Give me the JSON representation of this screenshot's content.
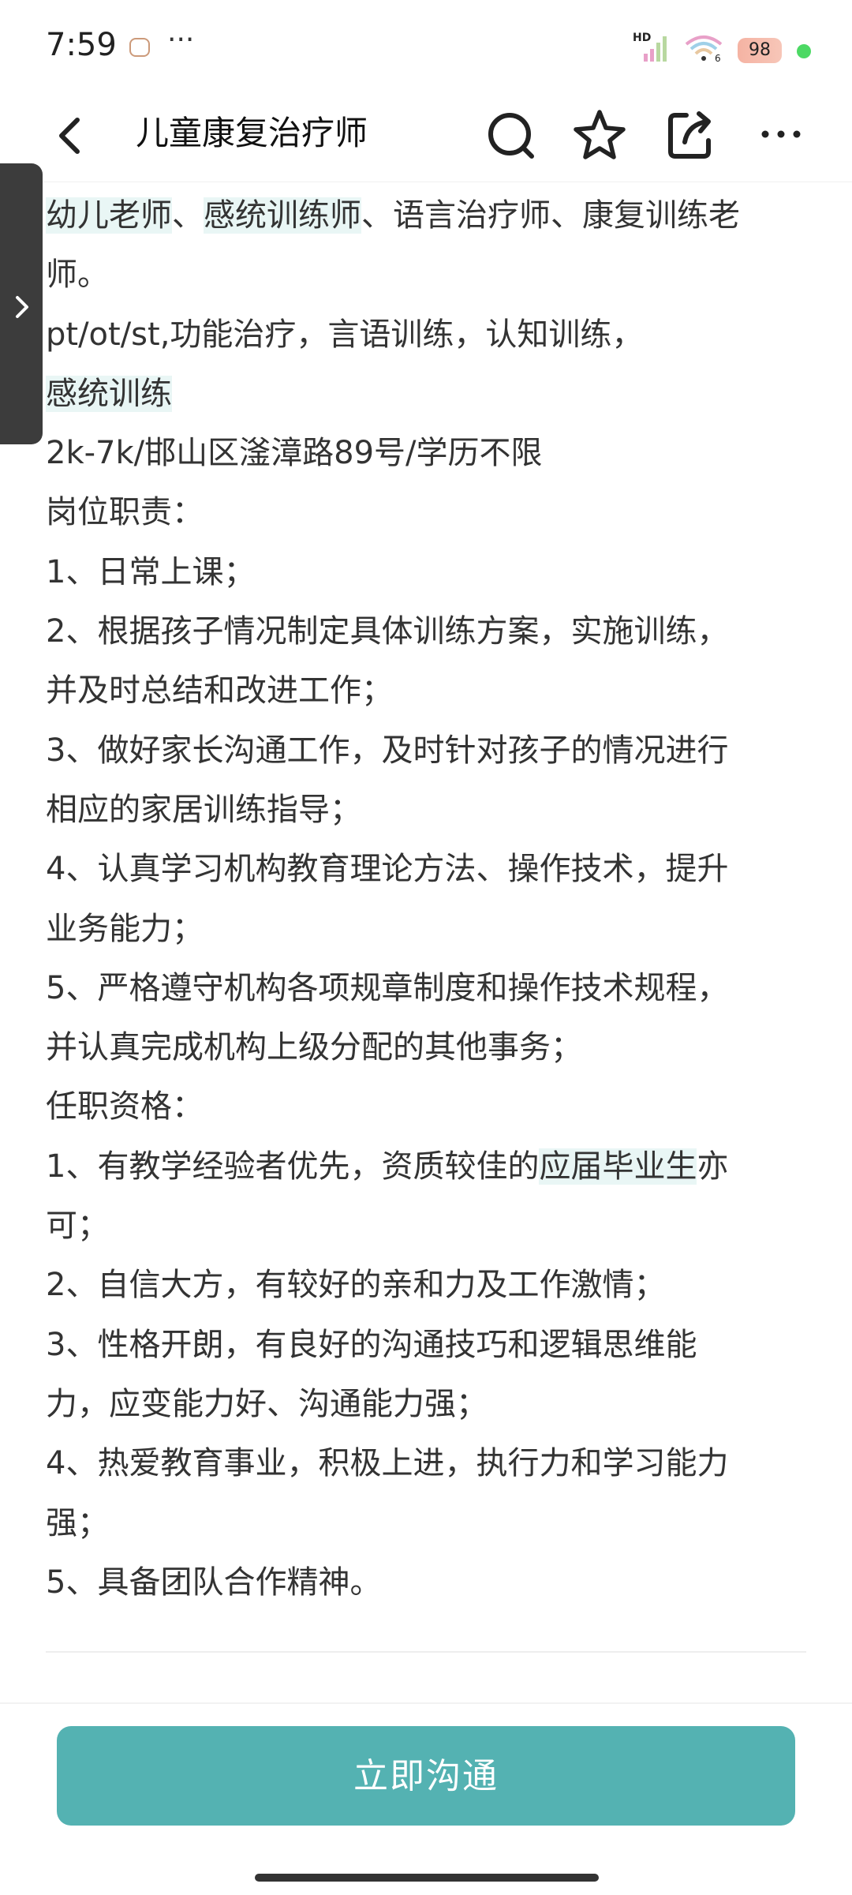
{
  "status_bar": {
    "time": "7:59",
    "more": "···",
    "network_badge": "HD",
    "wifi_badge": "6",
    "battery": "98"
  },
  "header": {
    "title": "儿童康复治疗师"
  },
  "content": {
    "line1_parts": [
      "幼儿老师",
      "、",
      "感统训练师",
      "、语言治疗师、康复训练老"
    ],
    "line2": "师。",
    "line3": "pt/ot/st,功能治疗，言语训练，认知训练，",
    "line4": "感统训练",
    "line5": "2k-7k/邯山区滏漳路89号/学历不限",
    "line6": "岗位职责：",
    "line7": "1、日常上课；",
    "line8": "2、根据孩子情况制定具体训练方案，实施训练，",
    "line9": "并及时总结和改进工作；",
    "line10": "3、做好家长沟通工作，及时针对孩子的情况进行",
    "line11": "相应的家居训练指导；",
    "line12": "4、认真学习机构教育理论方法、操作技术，提升",
    "line13": "业务能力；",
    "line14": "5、严格遵守机构各项规章制度和操作技术规程，",
    "line15": "并认真完成机构上级分配的其他事务；",
    "line16": "任职资格：",
    "line17_parts": [
      "1、有教学经验者优先，资质较佳的",
      "应届毕业生",
      "亦"
    ],
    "line18": "可；",
    "line19": "2、自信大方，有较好的亲和力及工作激情；",
    "line20": "3、性格开朗，有良好的沟通技巧和逻辑思维能",
    "line21": "力，应变能力好、沟通能力强；",
    "line22": "4、热爱教育事业，积极上进，执行力和学习能力",
    "line23": "强；",
    "line24": "5、具备团队合作精神。"
  },
  "bottom": {
    "chat_button": "立即沟通"
  },
  "colors": {
    "accent": "#54b2b2",
    "highlight": "#e9f6f5",
    "handle": "#3c3c3c"
  },
  "icons": {
    "back": "chevron-left-icon",
    "search": "search-icon",
    "favorite": "star-icon",
    "share": "share-icon",
    "more": "more-icon",
    "drawer": "chevron-right-icon"
  }
}
